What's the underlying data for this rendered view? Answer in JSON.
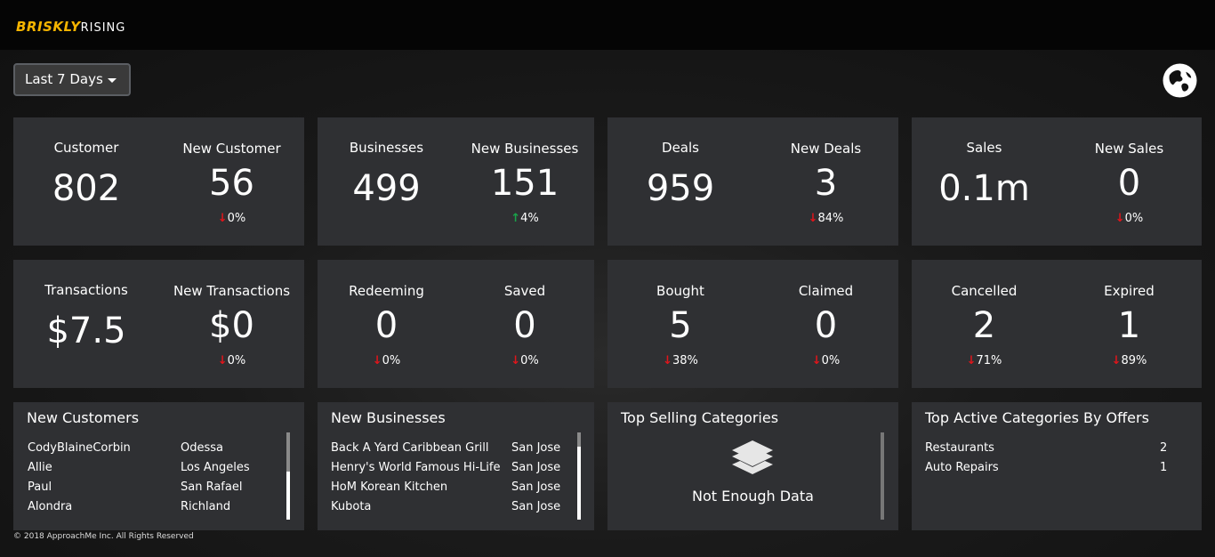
{
  "app": {
    "logo_part1": "BRISKLY",
    "logo_part2": "RISING",
    "accent_color": "#f5b400"
  },
  "toolbar": {
    "range_label": "Last 7 Days",
    "globe_icon": "globe-icon"
  },
  "stats_row1": [
    {
      "label": "Customer",
      "value": "802",
      "new_label": "New Customer",
      "new_value": "56",
      "change": "0%",
      "trend": "down"
    },
    {
      "label": "Businesses",
      "value": "499",
      "new_label": "New Businesses",
      "new_value": "151",
      "change": "4%",
      "trend": "up"
    },
    {
      "label": "Deals",
      "value": "959",
      "new_label": "New Deals",
      "new_value": "3",
      "change": "84%",
      "trend": "down"
    },
    {
      "label": "Sales",
      "value": "0.1m",
      "new_label": "New Sales",
      "new_value": "0",
      "change": "0%",
      "trend": "down"
    }
  ],
  "stats_row2": [
    {
      "label": "Transactions",
      "value": "$7.5",
      "new_label": "New Transactions",
      "new_value": "$0",
      "change": "0%",
      "trend": "down"
    },
    {
      "left_label": "Redeeming",
      "left_value": "0",
      "left_change": "0%",
      "right_label": "Saved",
      "right_value": "0",
      "right_change": "0%"
    },
    {
      "left_label": "Bought",
      "left_value": "5",
      "left_change": "38%",
      "right_label": "Claimed",
      "right_value": "0",
      "right_change": "0%"
    },
    {
      "left_label": "Cancelled",
      "left_value": "2",
      "left_change": "71%",
      "right_label": "Expired",
      "right_value": "1",
      "right_change": "89%"
    }
  ],
  "new_customers": {
    "title": "New Customers",
    "rows": [
      {
        "name": "CodyBlaineCorbin",
        "city": "Odessa"
      },
      {
        "name": "Allie",
        "city": "Los Angeles"
      },
      {
        "name": "Paul",
        "city": "San Rafael"
      },
      {
        "name": "Alondra",
        "city": "Richland"
      }
    ]
  },
  "new_businesses": {
    "title": "New Businesses",
    "rows": [
      {
        "name": "Back A Yard Caribbean Grill",
        "city": "San Jose"
      },
      {
        "name": "Henry's World Famous Hi-Life",
        "city": "San Jose"
      },
      {
        "name": "HoM Korean Kitchen",
        "city": "San Jose"
      },
      {
        "name": "Kubota",
        "city": "San Jose"
      }
    ]
  },
  "top_selling": {
    "title": "Top Selling Categories",
    "empty_text": "Not Enough Data",
    "icon": "layers-icon"
  },
  "top_active": {
    "title": "Top Active Categories By Offers",
    "rows": [
      {
        "name": "Restaurants",
        "count": "2"
      },
      {
        "name": "Auto Repairs",
        "count": "1"
      }
    ]
  },
  "footer": {
    "text": "© 2018 ApproachMe Inc. All Rights Reserved"
  },
  "colors": {
    "down": "#e0151b",
    "up": "#19a34a",
    "card": "#2f3033"
  }
}
